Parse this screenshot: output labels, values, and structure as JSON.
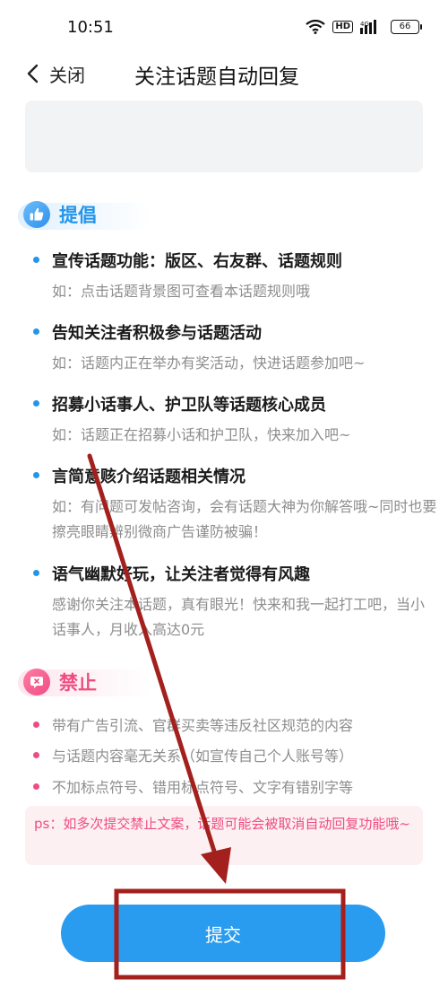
{
  "status_bar": {
    "time": "10:51",
    "network": "HD",
    "signal_tag": "4G",
    "battery": "66",
    "icons": [
      "wifi-icon",
      "hd-icon",
      "signal-icon",
      "battery-icon"
    ]
  },
  "nav": {
    "back_icon": "chevron-left-icon",
    "back_label": "关闭",
    "title": "关注话题自动回复"
  },
  "advocate": {
    "title": "提倡",
    "icon": "thumbs-up-icon",
    "tips": [
      {
        "title": "宣传话题功能：版区、右友群、话题规则",
        "desc": "如：点击话题背景图可查看本话题规则哦"
      },
      {
        "title": "告知关注者积极参与话题活动",
        "desc": "如：话题内正在举办有奖活动，快进话题参加吧~"
      },
      {
        "title": "招募小话事人、护卫队等话题核心成员",
        "desc": "如：话题正在招募小话和护卫队，快来加入吧~"
      },
      {
        "title": "言简意赅介绍话题相关情况",
        "desc": "如：有问题可发帖咨询，会有话题大神为你解答哦~同时也要擦亮眼睛辨别微商广告谨防被骗！"
      },
      {
        "title": "语气幽默好玩，让关注者觉得有风趣",
        "desc": "感谢你关注本话题，真有眼光！快来和我一起打工吧，当小话事人，月收入高达0元"
      }
    ]
  },
  "forbid": {
    "title": "禁止",
    "icon": "forbidden-icon",
    "rules": [
      "带有广告引流、官群买卖等违反社区规范的内容",
      "与话题内容毫无关系（如宣传自己个人账号等）",
      "不加标点符号、错用标点符号、文字有错别字等"
    ]
  },
  "ps_note": "ps：如多次提交禁止文案，话题可能会被取消自动回复功能哦~",
  "submit_label": "提交",
  "colors": {
    "accent_blue": "#2496ea",
    "accent_pink": "#ee4d7f",
    "annotation_red": "#a3201d"
  }
}
